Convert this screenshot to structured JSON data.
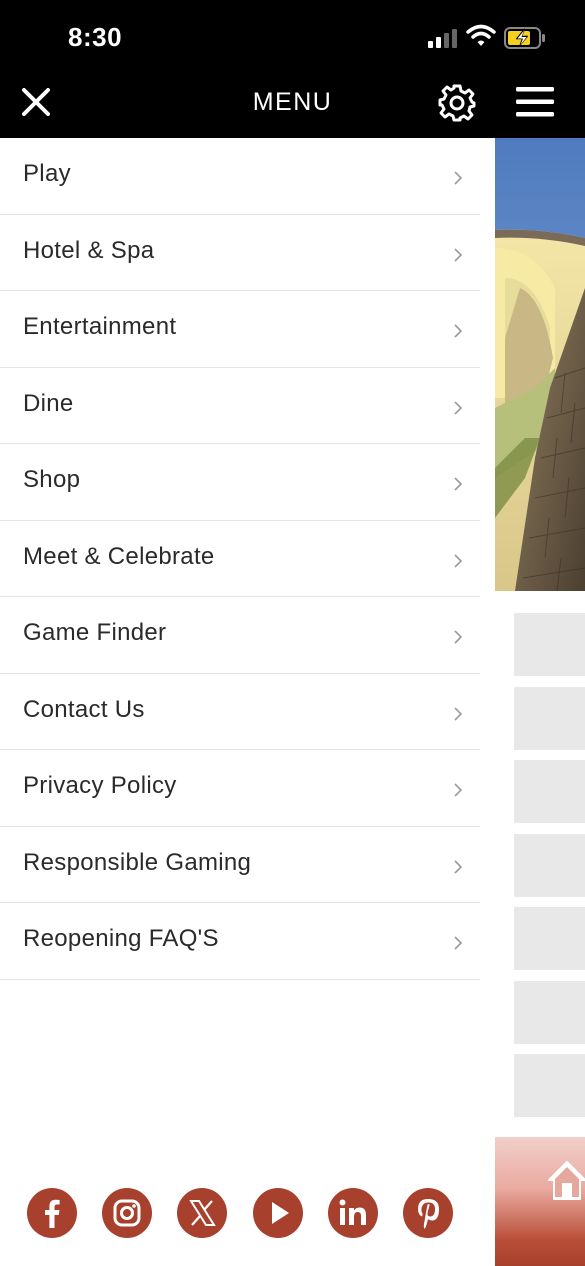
{
  "status_bar": {
    "time": "8:30"
  },
  "header": {
    "title": "MENU",
    "close_icon": "close-icon",
    "settings_icon": "gear-icon",
    "menu_icon": "hamburger-icon"
  },
  "menu": {
    "items": [
      {
        "label": "Play"
      },
      {
        "label": "Hotel & Spa"
      },
      {
        "label": "Entertainment"
      },
      {
        "label": "Dine"
      },
      {
        "label": "Shop"
      },
      {
        "label": "Meet & Celebrate"
      },
      {
        "label": "Game Finder"
      },
      {
        "label": "Contact Us"
      },
      {
        "label": "Privacy Policy"
      },
      {
        "label": "Responsible Gaming"
      },
      {
        "label": "Reopening FAQ'S"
      }
    ]
  },
  "social": {
    "icons": [
      "facebook-icon",
      "instagram-icon",
      "x-icon",
      "youtube-icon",
      "linkedin-icon",
      "pinterest-icon"
    ]
  },
  "colors": {
    "header_bg": "#000000",
    "social_accent": "#a8402e",
    "divider": "#e3e3e3",
    "battery_charging": "#f5d020"
  }
}
